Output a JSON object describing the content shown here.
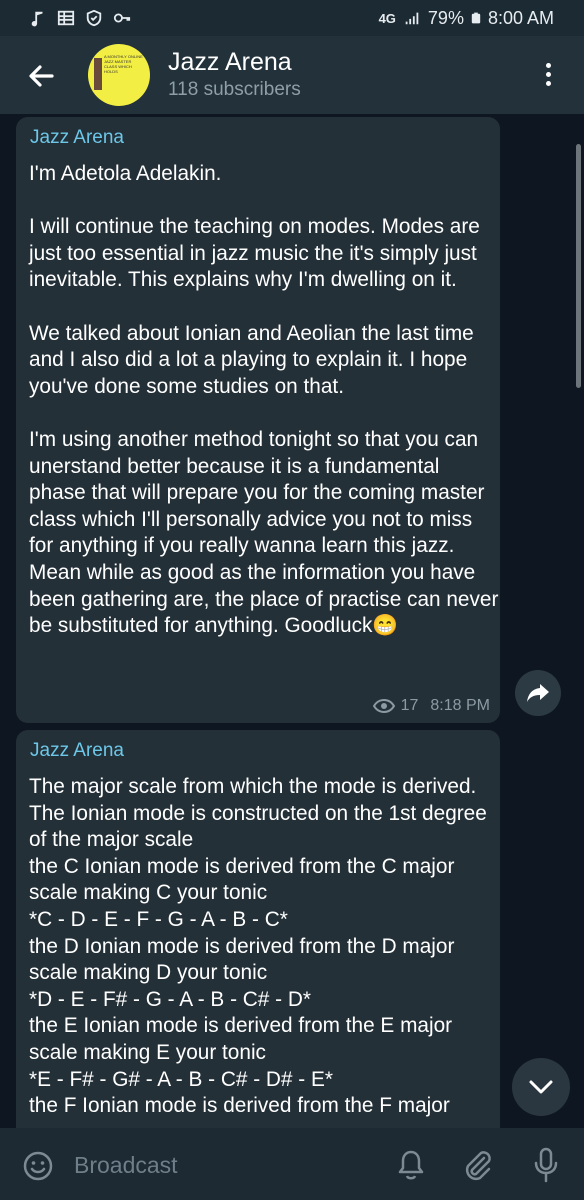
{
  "status_bar": {
    "network": "4G",
    "battery": "79%",
    "time": "8:00 AM",
    "icons": [
      "music-note-icon",
      "grid-icon",
      "shield-icon",
      "key-icon",
      "signal-icon",
      "battery-icon"
    ]
  },
  "header": {
    "title": "Jazz Arena",
    "subtitle": "118 subscribers",
    "avatar_text": "A MONTHLY ONLINE JAZZ MASTER CLASS WHICH HOLDS"
  },
  "messages": [
    {
      "sender": "Jazz Arena",
      "text": "I'm Adetola Adelakin.\n\nI will continue the teaching on modes. Modes are just too essential in jazz music the it's simply just inevitable. This explains why I'm dwelling on it.\n\nWe talked about Ionian and Aeolian the last time and I also did a lot a playing to explain it. I hope you've done some studies on that.\n\nI'm using another method tonight so that you can unerstand better because it is a fundamental phase that will prepare you for the coming master class which I'll personally advice you not to miss for anything if you really wanna learn this jazz.\nMean while as good as the information you have been gathering are, the place of practise can never be substituted for anything. Goodluck😁",
      "views": "17",
      "time": "8:18 PM"
    },
    {
      "sender": "Jazz Arena",
      "text": "The major scale from which the mode is derived.\nThe Ionian mode is constructed on the 1st degree of the major scale\nthe C Ionian mode is derived from the C major scale making C your tonic\n*C - D - E - F - G - A - B - C*\nthe D Ionian mode is derived from the D major scale making D your tonic\n*D - E - F# - G - A - B - C# - D*\nthe E Ionian mode is derived from the E major scale making E your tonic\n*E - F# - G# - A - B - C# - D# - E*\nthe F Ionian mode is derived from the F major"
    }
  ],
  "bottom_bar": {
    "placeholder": "Broadcast"
  },
  "colors": {
    "background": "#0e1621",
    "header": "#22313a",
    "bubble": "#243038",
    "sender": "#6cc7e8",
    "meta": "#8c9aa3"
  }
}
